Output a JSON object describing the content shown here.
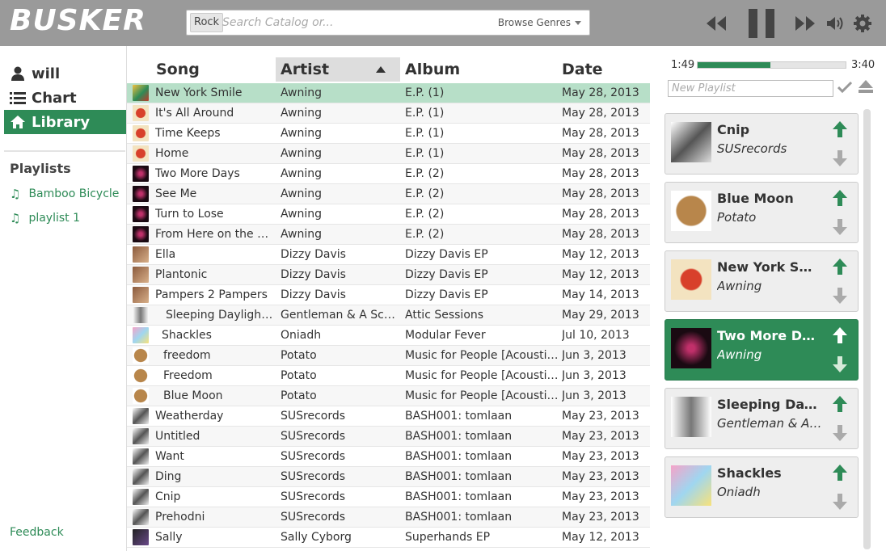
{
  "app": {
    "logo": "BUSKER"
  },
  "search": {
    "tag": "Rock",
    "placeholder": "Search Catalog or...",
    "browse_label": "Browse Genres"
  },
  "sidebar": {
    "nav": [
      {
        "label": "will",
        "icon": "user-icon"
      },
      {
        "label": "Chart",
        "icon": "list-icon"
      },
      {
        "label": "Library",
        "icon": "home-icon"
      }
    ],
    "playlists_heading": "Playlists",
    "playlists": [
      "Bamboo Bicycle",
      "playlist 1"
    ],
    "feedback": "Feedback"
  },
  "table": {
    "headers": {
      "song": "Song",
      "artist": "Artist",
      "album": "Album",
      "date": "Date"
    },
    "rows": [
      {
        "song": "New York Smile",
        "artist": "Awning",
        "album": "E.P. (1)",
        "date": "May 28, 2013"
      },
      {
        "song": "It's All Around",
        "artist": "Awning",
        "album": "E.P. (1)",
        "date": "May 28, 2013"
      },
      {
        "song": "Time Keeps",
        "artist": "Awning",
        "album": "E.P. (1)",
        "date": "May 28, 2013"
      },
      {
        "song": "Home",
        "artist": "Awning",
        "album": "E.P. (1)",
        "date": "May 28, 2013"
      },
      {
        "song": "Two More Days",
        "artist": "Awning",
        "album": "E.P. (2)",
        "date": "May 28, 2013"
      },
      {
        "song": "See Me",
        "artist": "Awning",
        "album": "E.P. (2)",
        "date": "May 28, 2013"
      },
      {
        "song": "Turn to Lose",
        "artist": "Awning",
        "album": "E.P. (2)",
        "date": "May 28, 2013"
      },
      {
        "song": "From Here on the Gr...",
        "artist": "Awning",
        "album": "E.P. (2)",
        "date": "May 28, 2013"
      },
      {
        "song": "Ella",
        "artist": "Dizzy Davis",
        "album": "Dizzy Davis EP",
        "date": "May 12, 2013"
      },
      {
        "song": "Plantonic",
        "artist": "Dizzy Davis",
        "album": "Dizzy Davis EP",
        "date": "May 12, 2013"
      },
      {
        "song": "Pampers 2 Pampers",
        "artist": "Dizzy Davis",
        "album": "Dizzy Davis EP",
        "date": "May 14, 2013"
      },
      {
        "song": "Sleeping Daylight (...",
        "artist": "Gentleman & A Scholar",
        "album": "Attic Sessions",
        "date": "May 29, 2013"
      },
      {
        "song": "Shackles",
        "artist": "Oniadh",
        "album": "Modular Fever",
        "date": "Jul 10, 2013"
      },
      {
        "song": "freedom",
        "artist": "Potato",
        "album": "Music for People [Acoustic EP]",
        "date": "Jun 3, 2013"
      },
      {
        "song": "Freedom",
        "artist": "Potato",
        "album": "Music for People [Acoustic EP]",
        "date": "Jun 3, 2013"
      },
      {
        "song": "Blue Moon",
        "artist": "Potato",
        "album": "Music for People [Acoustic EP]",
        "date": "Jun 3, 2013"
      },
      {
        "song": "Weatherday",
        "artist": "SUSrecords",
        "album": "BASH001: tomlaan",
        "date": "May 23, 2013"
      },
      {
        "song": "Untitled",
        "artist": "SUSrecords",
        "album": "BASH001: tomlaan",
        "date": "May 23, 2013"
      },
      {
        "song": "Want",
        "artist": "SUSrecords",
        "album": "BASH001: tomlaan",
        "date": "May 23, 2013"
      },
      {
        "song": "Ding",
        "artist": "SUSrecords",
        "album": "BASH001: tomlaan",
        "date": "May 23, 2013"
      },
      {
        "song": "Cnip",
        "artist": "SUSrecords",
        "album": "BASH001: tomlaan",
        "date": "May 23, 2013"
      },
      {
        "song": "Prehodni",
        "artist": "SUSrecords",
        "album": "BASH001: tomlaan",
        "date": "May 23, 2013"
      },
      {
        "song": "Sally",
        "artist": "Sally Cyborg",
        "album": "Superhands EP",
        "date": "May 12, 2013"
      }
    ]
  },
  "player": {
    "elapsed": "1:49",
    "duration": "3:40",
    "progress": 0.49
  },
  "queue": {
    "new_playlist_placeholder": "New Playlist",
    "items": [
      {
        "title": "Cnip",
        "artist": "SUSrecords"
      },
      {
        "title": "Blue Moon",
        "artist": "Potato"
      },
      {
        "title": "New York Smile",
        "artist": "Awning"
      },
      {
        "title": "Two More Days",
        "artist": "Awning"
      },
      {
        "title": "Sleeping Daylight (...",
        "artist": "Gentleman & A Scholar"
      },
      {
        "title": "Shackles",
        "artist": "Oniadh"
      }
    ]
  },
  "colors": {
    "accent": "#2e8b57",
    "topbar": "#9a9a9a",
    "selected_row": "#b7dfc8"
  }
}
